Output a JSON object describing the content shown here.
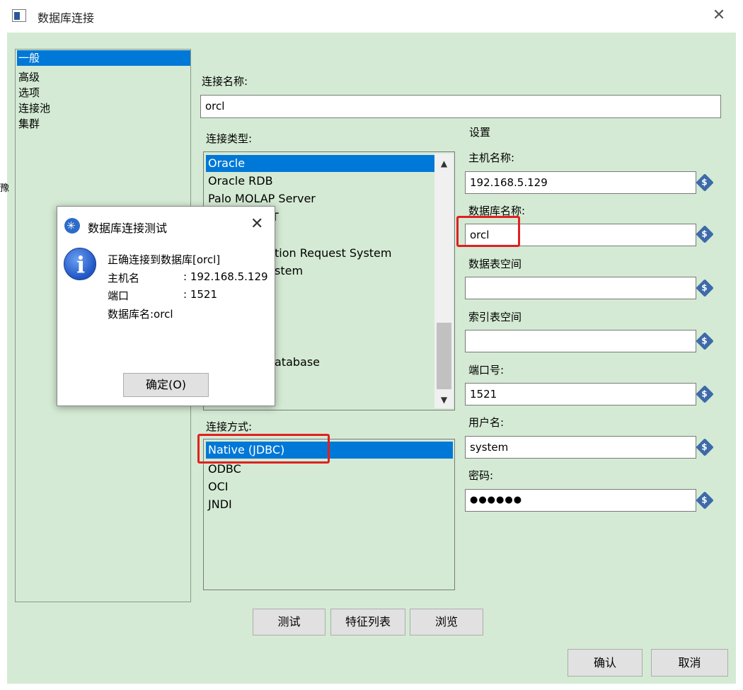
{
  "window": {
    "title": "数据库连接",
    "close_glyph": "✕"
  },
  "nav": {
    "items": [
      "一般",
      "高级",
      "选项",
      "连接池",
      "集群"
    ],
    "selected": 0
  },
  "side_char": "豫",
  "connection_name": {
    "label": "连接名称:",
    "value": "orcl"
  },
  "connection_type": {
    "label": "连接类型:",
    "items": [
      "Oracle",
      "Oracle RDB",
      "Palo MOLAP Server",
      "…",
      "…",
      "…ation Request System",
      "…stem",
      "",
      "",
      "",
      "…atabase"
    ],
    "visible_items": {
      "oracle": "Oracle",
      "oracle_rdb": "Oracle RDB",
      "palo": "Palo MOLAP Server",
      "partial_1": "T",
      "partial_2": "tion Request System",
      "partial_3": "stem",
      "partial_4": "atabase"
    }
  },
  "access": {
    "label": "连接方式:",
    "items": [
      "Native (JDBC)",
      "ODBC",
      "OCI",
      "JNDI"
    ],
    "selected": 0
  },
  "settings": {
    "label": "设置",
    "host_label": "主机名称:",
    "host_value": "192.168.5.129",
    "db_label": "数据库名称:",
    "db_value": "orcl",
    "tablespace_label": "数据表空间",
    "tablespace_value": "",
    "index_label": "索引表空间",
    "index_value": "",
    "port_label": "端口号:",
    "port_value": "1521",
    "user_label": "用户名:",
    "user_value": "system",
    "pass_label": "密码:",
    "pass_value": "●●●●●●"
  },
  "buttons": {
    "test": "测试",
    "features": "特征列表",
    "browse": "浏览",
    "ok": "确认",
    "cancel": "取消"
  },
  "dialog": {
    "title": "数据库连接测试",
    "close_glyph": "✕",
    "line1": "正确连接到数据库[orcl]",
    "host_label": "主机名",
    "host_value": ": 192.168.5.129",
    "port_label": "端口",
    "port_value": ": 1521",
    "db_line": "数据库名:orcl",
    "ok": "确定(O)"
  },
  "colors": {
    "panel": "#d4ead4",
    "selection": "#0078d7",
    "highlight": "#e02020"
  }
}
